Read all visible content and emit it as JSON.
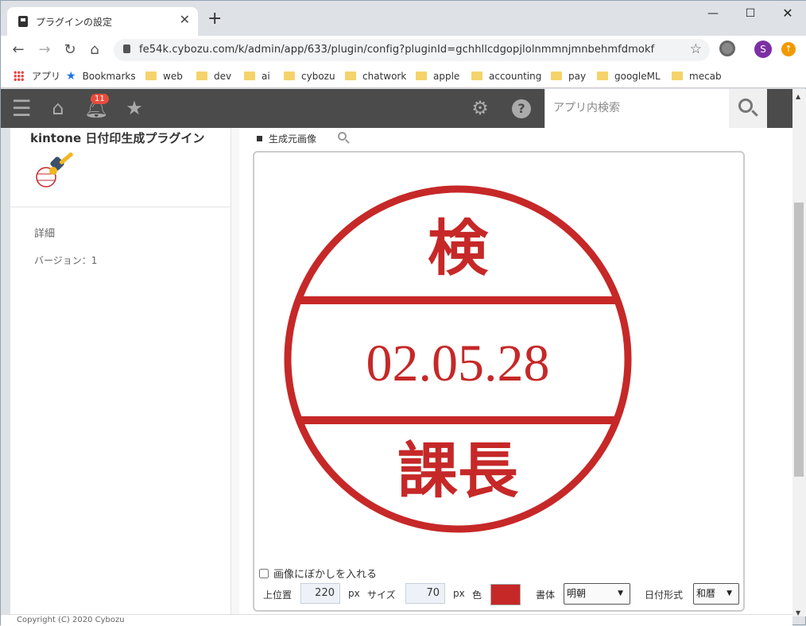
{
  "browser": {
    "tab_title": "プラグインの設定",
    "url": "fe54k.cybozu.com/k/admin/app/633/plugin/config?pluginId=gchhllcdgopjlolnmmnjmnbehmfdmokf",
    "avatar_letter": "S",
    "bookmarks": [
      "アプリ",
      "Bookmarks",
      "web",
      "dev",
      "ai",
      "cybozu",
      "chatwork",
      "apple",
      "accounting",
      "pay",
      "googleML",
      "mecab"
    ]
  },
  "header": {
    "notification_count": "11",
    "search_placeholder": "アプリ内検索"
  },
  "plugin": {
    "title": "kintone 日付印生成プラグイン",
    "details_label": "詳細",
    "version_label": "バージョン：1"
  },
  "preview": {
    "label": "生成元画像",
    "stamp": {
      "top_text": "検",
      "date_text": "02.05.28",
      "bottom_text": "課長",
      "color": "#c62828"
    }
  },
  "options": {
    "blur_label": "画像にぼかしを入れる",
    "blur_checked": false,
    "position_label": "上位置",
    "position_value": "220",
    "position_unit": "px",
    "size_label": "サイズ",
    "size_value": "70",
    "size_unit": "px",
    "color_label": "色",
    "font_label": "書体",
    "font_value": "明朝",
    "date_format_label": "日付形式",
    "date_format_value": "和暦"
  },
  "footer": {
    "copyright": "Copyright (C) 2020 Cybozu"
  }
}
